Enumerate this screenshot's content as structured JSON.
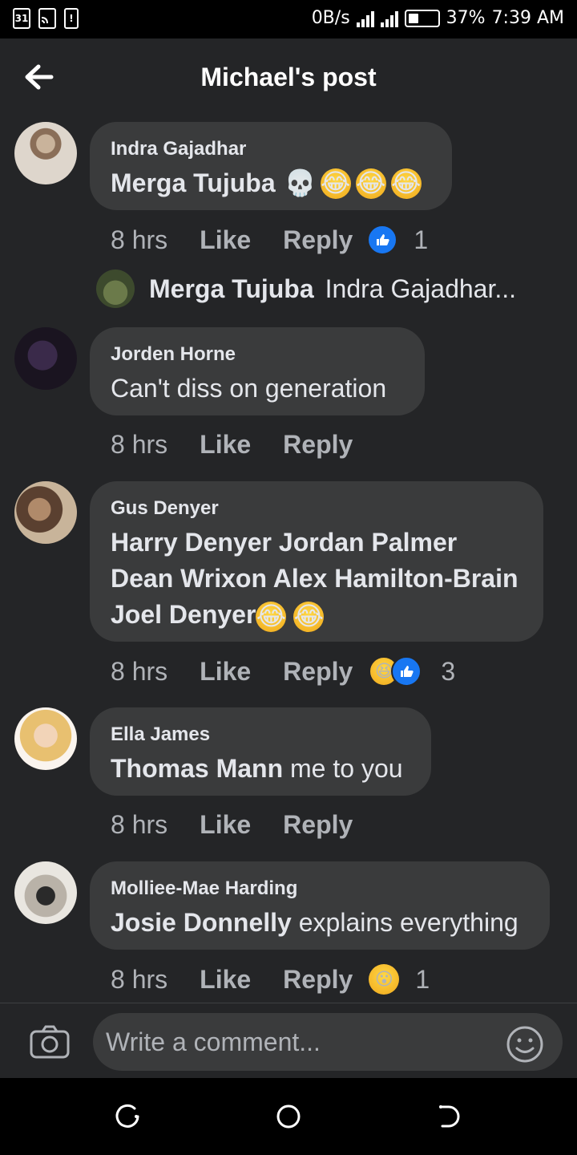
{
  "status": {
    "speed": "0B/s",
    "battery": "37%",
    "battery_level": 0.37,
    "time": "7:39 AM",
    "left_icons": [
      "31",
      "cast-icon",
      "alert-icon"
    ]
  },
  "header": {
    "title": "Michael's post"
  },
  "comments": [
    {
      "author": "Indra Gajadhar",
      "mention": "Merga Tujuba",
      "text": "",
      "emojis": "skull-laugh-laugh-laugh",
      "time": "8 hrs",
      "like": "Like",
      "reply": "Reply",
      "reaction_count": "1"
    },
    {
      "author": "Jorden Horne",
      "mention": "",
      "text": "Can't diss on generation",
      "time": "8 hrs",
      "like": "Like",
      "reply": "Reply"
    },
    {
      "author": "Gus Denyer",
      "mention": "Harry Denyer Jordan Palmer Dean Wrixon Alex Hamilton-Brain Joel Denyer",
      "text": "",
      "time": "8 hrs",
      "like": "Like",
      "reply": "Reply",
      "reaction_count": "3"
    },
    {
      "author": "Ella James",
      "mention": "Thomas Mann",
      "text": " me to you",
      "time": "8 hrs",
      "like": "Like",
      "reply": "Reply"
    },
    {
      "author": "Molliee-Mae Harding",
      "mention": "Josie Donnelly",
      "text": " explains everything",
      "time": "8 hrs",
      "like": "Like",
      "reply": "Reply",
      "reaction_count": "1"
    }
  ],
  "reply_preview": {
    "author": "Merga Tujuba",
    "text": "Indra Gajadhar..."
  },
  "composer": {
    "placeholder": "Write a comment..."
  },
  "colors": {
    "background": "#242527",
    "bubble": "#3a3b3c",
    "like_blue": "#1877f2",
    "text": "#e4e6eb",
    "muted": "#b0b3b8"
  }
}
